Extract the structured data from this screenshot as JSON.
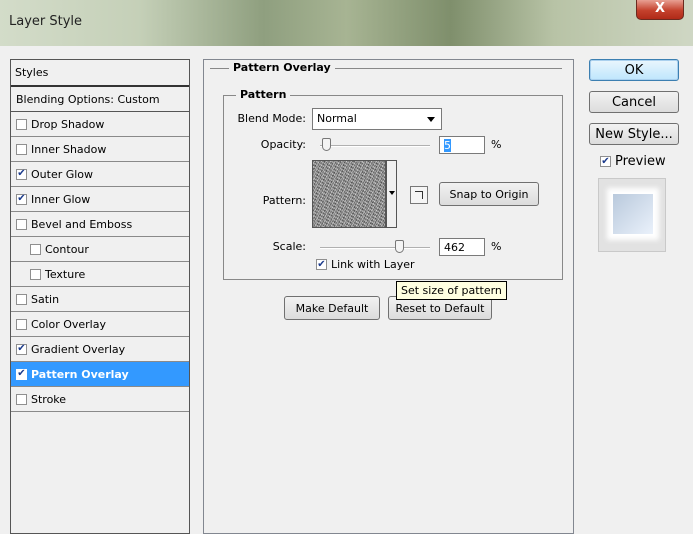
{
  "window": {
    "title": "Layer Style",
    "close_glyph": "X"
  },
  "styles_panel": {
    "header": "Styles",
    "items": [
      {
        "label": "Blending Options: Custom",
        "has_checkbox": false,
        "checked": false,
        "indent": false,
        "selected": false
      },
      {
        "label": "Drop Shadow",
        "has_checkbox": true,
        "checked": false,
        "indent": false,
        "selected": false
      },
      {
        "label": "Inner Shadow",
        "has_checkbox": true,
        "checked": false,
        "indent": false,
        "selected": false
      },
      {
        "label": "Outer Glow",
        "has_checkbox": true,
        "checked": true,
        "indent": false,
        "selected": false
      },
      {
        "label": "Inner Glow",
        "has_checkbox": true,
        "checked": true,
        "indent": false,
        "selected": false
      },
      {
        "label": "Bevel and Emboss",
        "has_checkbox": true,
        "checked": false,
        "indent": false,
        "selected": false
      },
      {
        "label": "Contour",
        "has_checkbox": true,
        "checked": false,
        "indent": true,
        "selected": false
      },
      {
        "label": "Texture",
        "has_checkbox": true,
        "checked": false,
        "indent": true,
        "selected": false
      },
      {
        "label": "Satin",
        "has_checkbox": true,
        "checked": false,
        "indent": false,
        "selected": false
      },
      {
        "label": "Color Overlay",
        "has_checkbox": true,
        "checked": false,
        "indent": false,
        "selected": false
      },
      {
        "label": "Gradient Overlay",
        "has_checkbox": true,
        "checked": true,
        "indent": false,
        "selected": false
      },
      {
        "label": "Pattern Overlay",
        "has_checkbox": true,
        "checked": true,
        "indent": false,
        "selected": true
      },
      {
        "label": "Stroke",
        "has_checkbox": true,
        "checked": false,
        "indent": false,
        "selected": false
      }
    ]
  },
  "pattern_overlay": {
    "section_title": "Pattern Overlay",
    "group_title": "Pattern",
    "blend_mode_label": "Blend Mode:",
    "blend_mode_value": "Normal",
    "opacity_label": "Opacity:",
    "opacity_value": "5",
    "opacity_unit": "%",
    "opacity_level": 0.05,
    "pattern_label": "Pattern:",
    "snap_to_origin_label": "Snap to Origin",
    "scale_label": "Scale:",
    "scale_value": "462",
    "scale_unit": "%",
    "scale_level": 0.462,
    "link_with_layer_label": "Link with Layer",
    "link_with_layer_checked": true,
    "make_default_label": "Make Default",
    "reset_to_default_label": "Reset to Default",
    "tooltip": "Set size of pattern"
  },
  "actions": {
    "ok_label": "OK",
    "cancel_label": "Cancel",
    "new_style_label": "New Style...",
    "preview_label": "Preview",
    "preview_checked": true
  }
}
